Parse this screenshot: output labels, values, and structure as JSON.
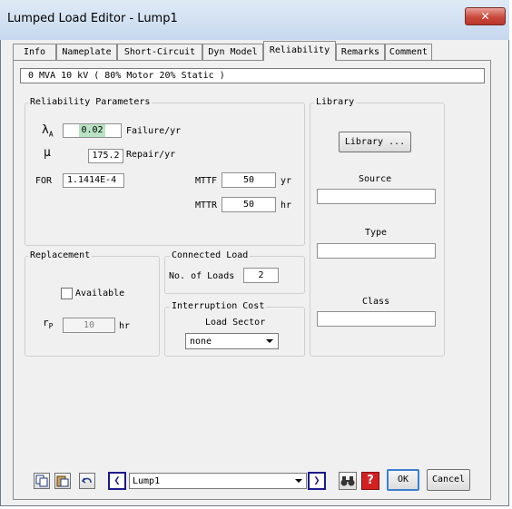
{
  "window": {
    "title": "Lumped Load Editor - Lump1",
    "close_glyph": "✕"
  },
  "tabs": [
    {
      "label": "Info"
    },
    {
      "label": "Nameplate"
    },
    {
      "label": "Short-Circuit"
    },
    {
      "label": "Dyn Model"
    },
    {
      "label": "Reliability"
    },
    {
      "label": "Remarks"
    },
    {
      "label": "Comment"
    }
  ],
  "active_tab": "Reliability",
  "info_bar": "0 MVA   10 kV  ( 80% Motor   20% Static )",
  "reliability": {
    "group_label": "Reliability Parameters",
    "lambda_symbol": "λ",
    "lambda_sub": "A",
    "lambda_value": "0.02",
    "lambda_unit": "Failure/yr",
    "mu_symbol": "μ",
    "mu_value": "175.2",
    "mu_unit": "Repair/yr",
    "for_label": "FOR",
    "for_value": "1.1414E-4",
    "mttf_label": "MTTF",
    "mttf_value": "50",
    "mttf_unit": "yr",
    "mttr_label": "MTTR",
    "mttr_value": "50",
    "mttr_unit": "hr"
  },
  "library": {
    "group_label": "Library",
    "button_label": "Library ...",
    "source_label": "Source",
    "source_value": "",
    "type_label": "Type",
    "type_value": "",
    "class_label": "Class",
    "class_value": ""
  },
  "replacement": {
    "group_label": "Replacement",
    "available_label": "Available",
    "available_checked": false,
    "rp_symbol": "r",
    "rp_sub": "P",
    "rp_value": "10",
    "rp_unit": "hr"
  },
  "connected_load": {
    "group_label": "Connected Load",
    "loads_label": "No. of Loads",
    "loads_value": "2"
  },
  "interruption_cost": {
    "group_label": "Interruption Cost",
    "sector_label": "Load Sector",
    "sector_value": "none"
  },
  "bottom": {
    "record_value": "Lump1",
    "ok_label": "OK",
    "cancel_label": "Cancel",
    "help_glyph": "?",
    "prev_glyph": "❮",
    "next_glyph": "❯"
  },
  "colors": {
    "selection_bg": "#b9e3c4",
    "accent_blue": "#1a1a8c",
    "help_red": "#d42020"
  }
}
